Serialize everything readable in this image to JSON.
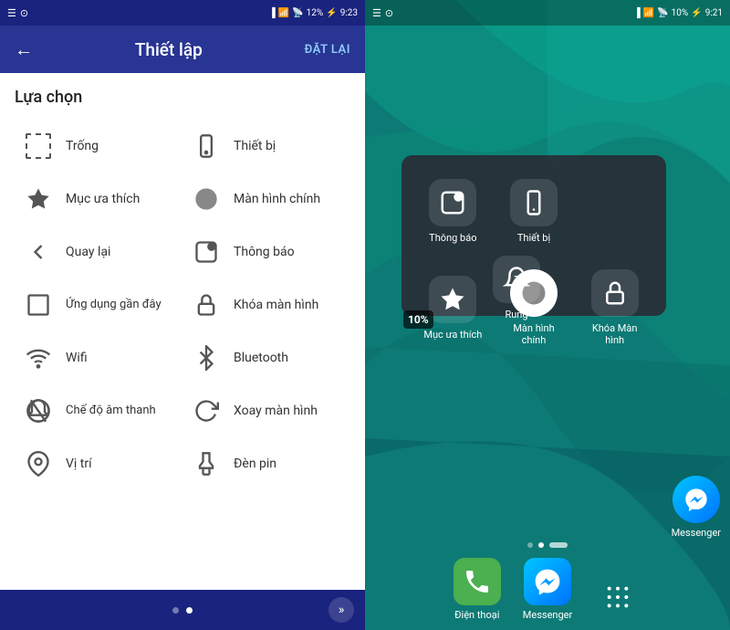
{
  "left": {
    "statusBar": {
      "leftIcon1": "☰",
      "leftIcon2": "⊙",
      "battery": "12%",
      "time": "9:23"
    },
    "title": "Thiết lập",
    "reset": "ĐẶT LẠI",
    "sectionTitle": "Lựa chọn",
    "items": [
      {
        "label": "Trống",
        "icon": "dashed-square"
      },
      {
        "label": "Thiết bị",
        "icon": "phone"
      },
      {
        "label": "Mục ưa thích",
        "icon": "star"
      },
      {
        "label": "Màn hình chính",
        "icon": "circle-filled"
      },
      {
        "label": "Quay lại",
        "icon": "back-triangle"
      },
      {
        "label": "Thông báo",
        "icon": "notification-badge"
      },
      {
        "label": "Ứng dụng gần đây",
        "icon": "square-outline"
      },
      {
        "label": "Khóa màn hình",
        "icon": "lock"
      },
      {
        "label": "Wifi",
        "icon": "wifi"
      },
      {
        "label": "Bluetooth",
        "icon": "bluetooth"
      },
      {
        "label": "Chế độ âm thanh",
        "icon": "mute-bell"
      },
      {
        "label": "Xoay màn hình",
        "icon": "rotate"
      },
      {
        "label": "Vị trí",
        "icon": "location"
      },
      {
        "label": "Đèn pin",
        "icon": "flashlight"
      }
    ],
    "nav": {
      "dots": [
        "inactive",
        "active"
      ],
      "arrowLabel": "»"
    }
  },
  "right": {
    "statusBar": {
      "leftIcon1": "☰",
      "leftIcon2": "⊙",
      "battery": "10%",
      "time": "9:21"
    },
    "popup": {
      "items": [
        {
          "label": "Thông báo",
          "icon": "notification"
        },
        {
          "label": "Thiết bị",
          "icon": "phone"
        },
        {
          "label": "Mục ưa thích",
          "icon": "star"
        },
        {
          "label": "Rung",
          "icon": "bell-z"
        },
        {
          "label": "Màn hình chính",
          "icon": "circle-white"
        },
        {
          "label": "Khóa Màn hình",
          "icon": "lock"
        }
      ]
    },
    "batteryOverlay": "10%",
    "dock": {
      "dots": [
        "inactive",
        "active",
        "dash"
      ],
      "apps": [
        {
          "label": "Điện thoại",
          "color": "#4caf50"
        },
        {
          "label": "Messenger",
          "color": "#1565c0"
        },
        {
          "label": "",
          "color": "transparent"
        }
      ]
    },
    "messenger": {
      "label": "Messenger",
      "position": "right"
    }
  }
}
